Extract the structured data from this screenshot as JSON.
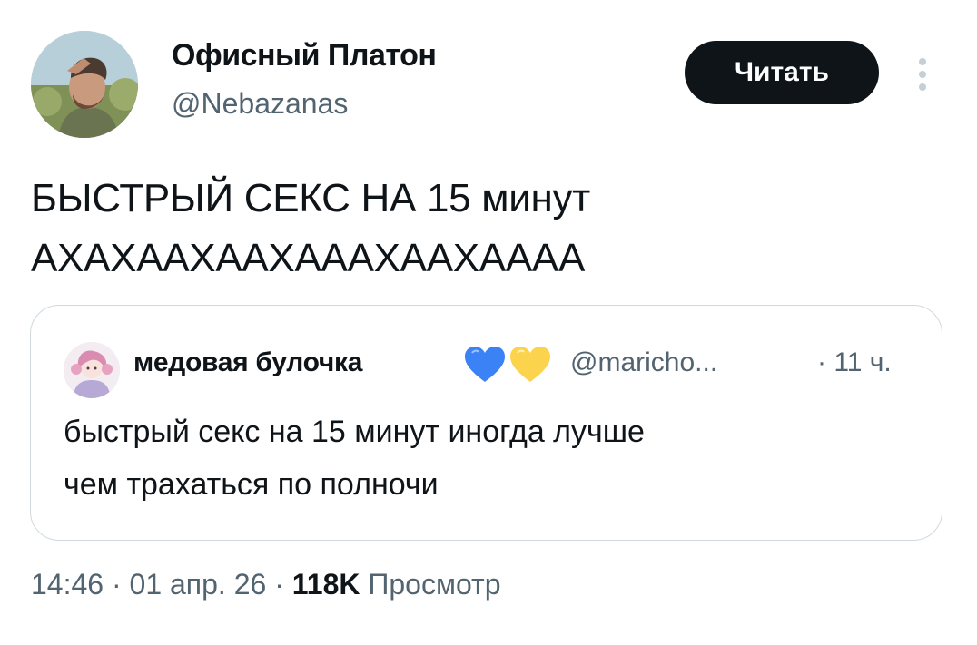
{
  "author": {
    "name": "Офисный Платон",
    "handle": "@Nebazanas"
  },
  "follow_button": {
    "label": "Читать"
  },
  "more_icon": "vertical-ellipsis",
  "tweet": {
    "lines": [
      "БЫСТРЫЙ СЕКС НА 15 минут",
      "АХАХААХААХАААХААХАААА"
    ]
  },
  "quote": {
    "author_name": "медовая булочка",
    "emojis": [
      "blue-heart",
      "yellow-heart"
    ],
    "handle": "@maricho...",
    "time": "· 11 ч.",
    "lines": [
      "быстрый секс на 15 минут иногда лучше",
      "чем трахаться по полночи"
    ]
  },
  "meta": {
    "time": "14:46",
    "date": "01 апр. 26",
    "separator": " · ",
    "views_count": "118K",
    "views_label": "Просмотр"
  },
  "colors": {
    "text_primary": "#0f1419",
    "text_secondary": "#536471",
    "border": "#cfd9de",
    "button_bg": "#0f1419",
    "heart_blue": "#3b82f6",
    "heart_yellow": "#fcd34d"
  }
}
